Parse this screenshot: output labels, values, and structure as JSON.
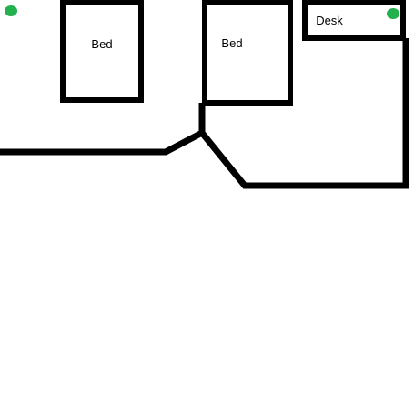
{
  "diagram": {
    "labels": {
      "bed_left": "Bed",
      "bed_right": "Bed",
      "desk": "Desk"
    },
    "colors": {
      "background": "#ffffff",
      "stroke": "#000000",
      "marker": "#22b14c"
    },
    "markers": [
      {
        "name": "marker-top-left"
      },
      {
        "name": "marker-desk"
      }
    ]
  }
}
